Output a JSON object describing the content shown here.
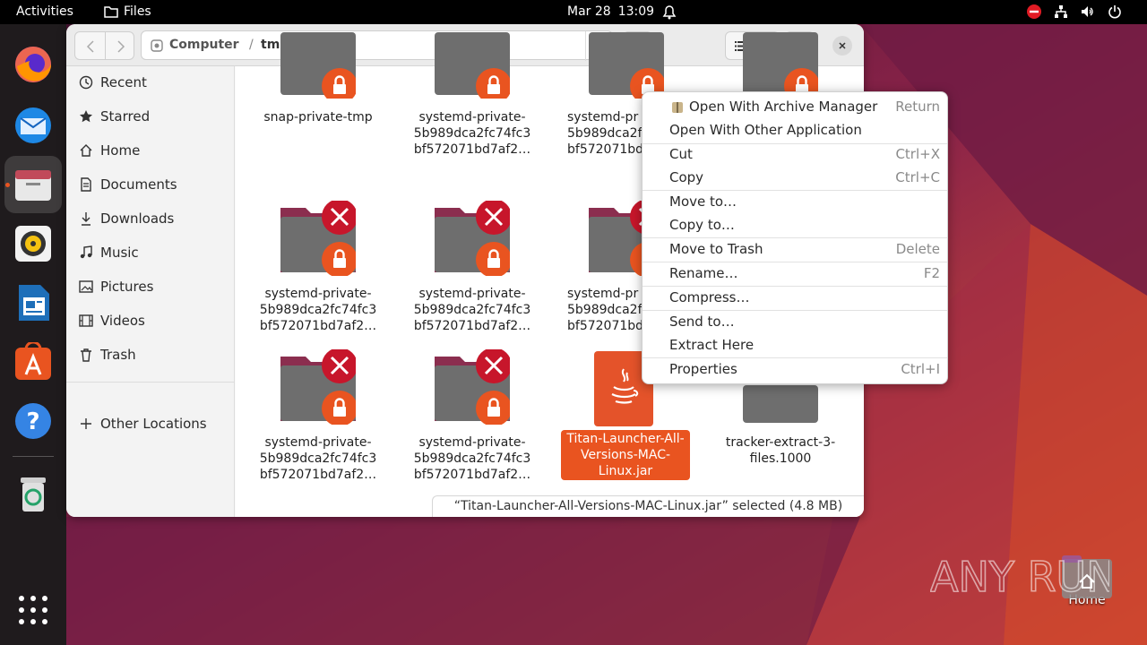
{
  "topbar": {
    "activities": "Activities",
    "app_name": "Files",
    "date": "Mar 28",
    "time": "13:09"
  },
  "dock": {
    "items": [
      "firefox-icon",
      "thunderbird-icon",
      "files-icon",
      "rhythmbox-icon",
      "libreoffice-writer-icon",
      "app-center-icon",
      "help-icon",
      "trash-icon",
      "show-apps-icon"
    ]
  },
  "headerbar": {
    "path": [
      "Computer",
      "/",
      "tmp"
    ]
  },
  "sidebar": {
    "items": [
      {
        "label": "Recent",
        "icon": "clock-icon"
      },
      {
        "label": "Starred",
        "icon": "star-icon"
      },
      {
        "label": "Home",
        "icon": "home-icon"
      },
      {
        "label": "Documents",
        "icon": "document-icon"
      },
      {
        "label": "Downloads",
        "icon": "download-icon"
      },
      {
        "label": "Music",
        "icon": "music-icon"
      },
      {
        "label": "Pictures",
        "icon": "picture-icon"
      },
      {
        "label": "Videos",
        "icon": "video-icon"
      },
      {
        "label": "Trash",
        "icon": "trash-icon"
      }
    ],
    "other_locations": "Other Locations"
  },
  "files": [
    {
      "line1": "snap-private-tmp",
      "line2": "",
      "line3": "",
      "locked": true,
      "denied": false
    },
    {
      "line1": "systemd-private-",
      "line2": "5b989dca2fc74fc3",
      "line3": "bf572071bd7af2…",
      "locked": true,
      "denied": false
    },
    {
      "line1": "systemd-pr",
      "line2": "5b989dca2f",
      "line3": "bf572071bd",
      "locked": true,
      "denied": false
    },
    {
      "line1": "",
      "line2": "",
      "line3": "",
      "locked": true,
      "denied": false
    },
    {
      "line1": "systemd-private-",
      "line2": "5b989dca2fc74fc3",
      "line3": "bf572071bd7af2…",
      "locked": true,
      "denied": true
    },
    {
      "line1": "systemd-private-",
      "line2": "5b989dca2fc74fc3",
      "line3": "bf572071bd7af2…",
      "locked": true,
      "denied": true
    },
    {
      "line1": "systemd-pr",
      "line2": "5b989dca2f",
      "line3": "bf572071bd",
      "locked": true,
      "denied": true
    },
    {
      "line1": "systemd-private-",
      "line2": "5b989dca2fc74fc3",
      "line3": "bf572071bd7af2…",
      "locked": true,
      "denied": true
    },
    {
      "line1": "systemd-private-",
      "line2": "5b989dca2fc74fc3",
      "line3": "bf572071bd7af2…",
      "locked": true,
      "denied": true
    },
    {
      "line1": "Titan-Launcher-All-",
      "line2": "Versions-MAC-",
      "line3": "Linux.jar",
      "locked": false,
      "denied": false,
      "selected": true
    },
    {
      "line1": "tracker-extract-3-",
      "line2": "files.1000",
      "line3": "",
      "locked": false,
      "denied": false
    }
  ],
  "status": "“Titan-Launcher-All-Versions-MAC-Linux.jar” selected  (4.8 MB)",
  "context_menu": {
    "items": [
      {
        "label": "Open With Archive Manager",
        "accel": "Return"
      },
      {
        "label": "Open With Other Application",
        "accel": ""
      },
      {
        "label": "Cut",
        "accel": "Ctrl+X"
      },
      {
        "label": "Copy",
        "accel": "Ctrl+C"
      },
      {
        "label": "Move to…",
        "accel": ""
      },
      {
        "label": "Copy to…",
        "accel": ""
      },
      {
        "label": "Move to Trash",
        "accel": "Delete"
      },
      {
        "label": "Rename…",
        "accel": "F2"
      },
      {
        "label": "Compress…",
        "accel": ""
      },
      {
        "label": "Send to…",
        "accel": ""
      },
      {
        "label": "Extract Here",
        "accel": ""
      },
      {
        "label": "Properties",
        "accel": "Ctrl+I"
      }
    ]
  },
  "desktop": {
    "home_label": "Home",
    "watermark": "ANY RUN"
  },
  "colors": {
    "accent": "#e95420",
    "folder": "#6e6e6e",
    "folder_tab": "#8b2e4f",
    "denied": "#c7162b"
  }
}
